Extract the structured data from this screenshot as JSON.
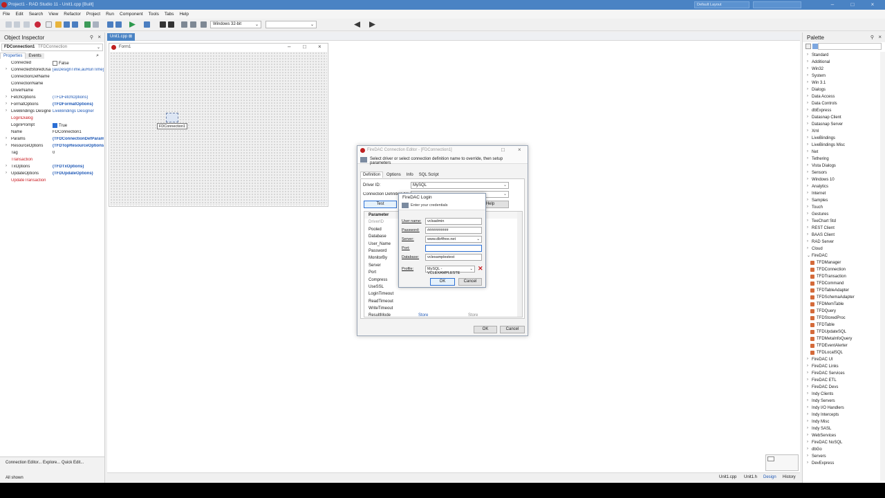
{
  "window": {
    "title": "Project1 - RAD Studio 11 - Unit1.cpp [Built]",
    "layout": "Default Layout"
  },
  "menu": [
    "File",
    "Edit",
    "Search",
    "View",
    "Refactor",
    "Project",
    "Run",
    "Component",
    "Tools",
    "Tabs",
    "Help"
  ],
  "toolbar": {
    "platform": "Windows 32-bit"
  },
  "object_inspector": {
    "title": "Object Inspector",
    "selected_name": "FDConnection1",
    "selected_type": "TFDConnection",
    "tab_properties": "Properties",
    "tab_events": "Events",
    "properties": [
      {
        "name": "Connected",
        "value": "False",
        "check": "off"
      },
      {
        "name": "ConnectedStoredUsa",
        "value": "[auDesignTime,auRunTime]",
        "exp": true,
        "vcolor": "blue"
      },
      {
        "name": "ConnectionDefName",
        "value": ""
      },
      {
        "name": "ConnectionName",
        "value": ""
      },
      {
        "name": "DriverName",
        "value": ""
      },
      {
        "name": "FetchOptions",
        "value": "(TFDFetchOptions)",
        "exp": true,
        "vcolor": "blue"
      },
      {
        "name": "FormatOptions",
        "value": "(TFDFormatOptions)",
        "exp": true,
        "vcolor": "blue",
        "bold": true
      },
      {
        "name": "LiveBindings Designer",
        "value": "LiveBindings Designer",
        "exp": true,
        "vcolor": "blue"
      },
      {
        "name": "LoginDialog",
        "value": "",
        "ncolor": "red"
      },
      {
        "name": "LoginPrompt",
        "value": "True",
        "check": "on"
      },
      {
        "name": "Name",
        "value": "FDConnection1"
      },
      {
        "name": "Params",
        "value": "(TFDConnectionDefParams)",
        "exp": true,
        "vcolor": "blue",
        "bold": true
      },
      {
        "name": "ResourceOptions",
        "value": "(TFDTopResourceOptions)",
        "exp": true,
        "vcolor": "blue",
        "bold": true
      },
      {
        "name": "Tag",
        "value": "0"
      },
      {
        "name": "Transaction",
        "value": "",
        "ncolor": "red"
      },
      {
        "name": "TxOptions",
        "value": "(TFDTxOptions)",
        "exp": true,
        "vcolor": "blue",
        "bold": true
      },
      {
        "name": "UpdateOptions",
        "value": "(TFDUpdateOptions)",
        "exp": true,
        "vcolor": "blue",
        "bold": true
      },
      {
        "name": "UpdateTransaction",
        "value": "",
        "ncolor": "red"
      }
    ],
    "bottom_links": "Connection Editor...  Explore...  Quick Edit...",
    "status": "All shown"
  },
  "editor": {
    "tab": "Unit1.cpp",
    "form_title": "Form1",
    "component_label": "FDConnection1",
    "status_tabs": [
      "Unit1.cpp",
      "Unit1.h",
      "Design",
      "History"
    ]
  },
  "palette": {
    "title": "Palette",
    "categories_top": [
      "Standard",
      "Additional",
      "Win32",
      "System",
      "Win 3.1",
      "Dialogs",
      "Data Access",
      "Data Controls",
      "dbExpress",
      "Datasnap Client",
      "Datasnap Server",
      "Xml",
      "LiveBindings",
      "LiveBindings Misc",
      "Net",
      "Tethering",
      "Vista Dialogs",
      "Sensors",
      "Windows 10",
      "Analytics",
      "Internet",
      "Samples",
      "Touch",
      "Gestures",
      "TeeChart Std",
      "REST Client",
      "BAAS Client",
      "RAD Server",
      "Cloud"
    ],
    "open_category": "FireDAC",
    "firedac_items": [
      "TFDManager",
      "TFDConnection",
      "TFDTransaction",
      "TFDCommand",
      "TFDTableAdapter",
      "TFDSchemaAdapter",
      "TFDMemTable",
      "TFDQuery",
      "TFDStoredProc",
      "TFDTable",
      "TFDUpdateSQL",
      "TFDMetaInfoQuery",
      "TFDEventAlerter",
      "TFDLocalSQL"
    ],
    "categories_bottom": [
      "FireDAC UI",
      "FireDAC Links",
      "FireDAC Services",
      "FireDAC ETL",
      "FireDAC Devs",
      "Indy Clients",
      "Indy Servers",
      "Indy I/O Handlers",
      "Indy Intercepts",
      "Indy Misc",
      "Indy SASL",
      "WebServices",
      "FireDAC NoSQL",
      "dbGo",
      "Servers",
      "DevExpress"
    ]
  },
  "conn_editor": {
    "title": "FireDAC Connection Editor - [FDConnection1]",
    "info": "Select driver or select connection definition name to override, then setup parameters",
    "tabs": [
      "Definition",
      "Options",
      "Info",
      "SQL Script"
    ],
    "driver_label": "Driver ID:",
    "driver_value": "MySQL",
    "conndef_label": "Connection Definition Name:",
    "test_button": "Test",
    "help_button": "Help",
    "param_header": "Parameter",
    "params": [
      {
        "k": "DriverID",
        "v": "",
        "d": ""
      },
      {
        "k": "Pooled",
        "v": "",
        "d": ""
      },
      {
        "k": "Database",
        "v": "",
        "d": ""
      },
      {
        "k": "User_Name",
        "v": "",
        "d": ""
      },
      {
        "k": "Password",
        "v": "",
        "d": ""
      },
      {
        "k": "MonitorBy",
        "v": "",
        "d": ""
      },
      {
        "k": "Server",
        "v": "",
        "d": ""
      },
      {
        "k": "Port",
        "v": "",
        "d": ""
      },
      {
        "k": "Compress",
        "v": "",
        "d": ""
      },
      {
        "k": "UseSSL",
        "v": "",
        "d": ""
      },
      {
        "k": "LoginTimeout",
        "v": "",
        "d": ""
      },
      {
        "k": "ReadTimeout",
        "v": "",
        "d": ""
      },
      {
        "k": "WriteTimeout",
        "v": "",
        "d": ""
      },
      {
        "k": "ResultMode",
        "v": "Store",
        "d": "Store"
      }
    ],
    "ok": "OK",
    "cancel": "Cancel"
  },
  "login": {
    "title": "FireDAC Login",
    "info": "Enter your credentials",
    "fields": [
      {
        "label": "User name:",
        "value": "vclsadmin"
      },
      {
        "label": "Password:",
        "value": "##########"
      },
      {
        "label": "Server:",
        "value": "www.db4free.net"
      },
      {
        "label": "Port:",
        "value": ""
      },
      {
        "label": "Database:",
        "value": "vclexamplestest"
      }
    ],
    "profile_label": "Profile:",
    "profile_value": "MySQL - VCLEXAMPLESTE",
    "ok": "OK",
    "cancel": "Cancel"
  }
}
